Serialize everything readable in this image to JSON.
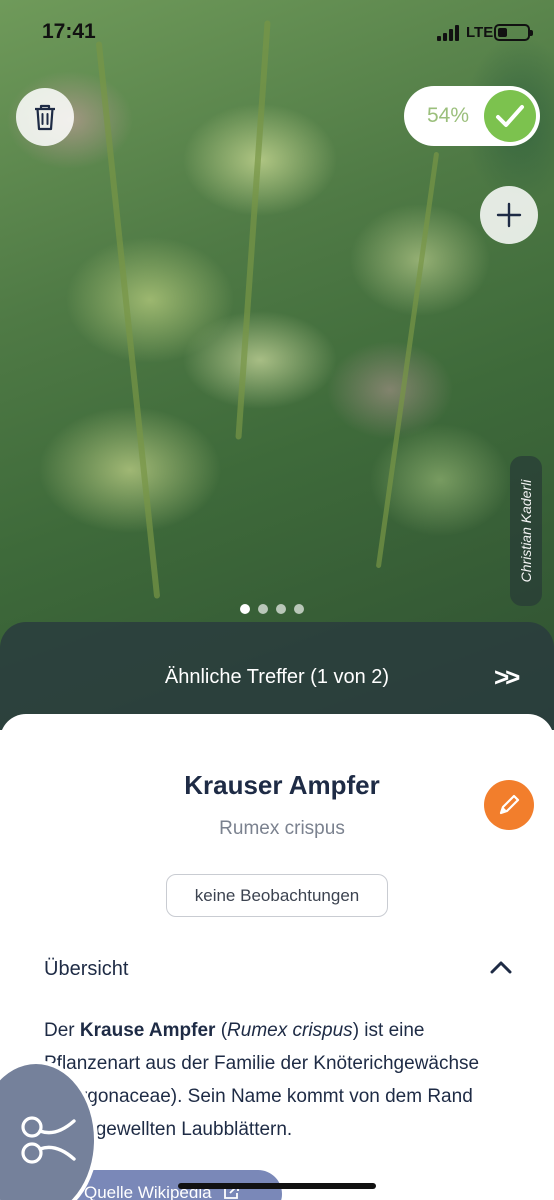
{
  "status_bar": {
    "time": "17:41",
    "network": "LTE",
    "battery_level": 0.25
  },
  "photo": {
    "confidence": "54%",
    "credit": "Christian Kaderli",
    "pages": 4,
    "current_page": 1
  },
  "icons": {
    "delete": "trash-icon",
    "confirm": "checkmark-icon",
    "add": "plus-icon",
    "next": "double-chevron-right-icon",
    "edit": "pencil-icon",
    "collapse": "chevron-up-icon",
    "external": "external-link-icon",
    "tool": "scissors-icon"
  },
  "similar_hits": {
    "label": "Ähnliche Treffer (1 von 2)",
    "next_symbol": ">>"
  },
  "species": {
    "name": "Krauser Ampfer",
    "latin": "Rumex crispus",
    "observations_label": "keine Beobachtungen"
  },
  "overview": {
    "heading": "Übersicht",
    "intro": "Der ",
    "bold_name": "Krause Ampfer",
    "paren_open": " (",
    "italic_latin": "Rumex crispus",
    "rest": ") ist eine Pflanzenart aus der Familie der Knöterichgewächse (Polygonaceae). Sein Name kommt von dem Rand kraus gewellten Laubblättern.",
    "source_label": "Quelle Wikipedia"
  },
  "colors": {
    "accent_green": "#7cc24e",
    "accent_orange": "#f27e2c",
    "title_navy": "#1e2b45",
    "fab_slate": "#75819b",
    "wiki_button": "#7a88b8"
  }
}
